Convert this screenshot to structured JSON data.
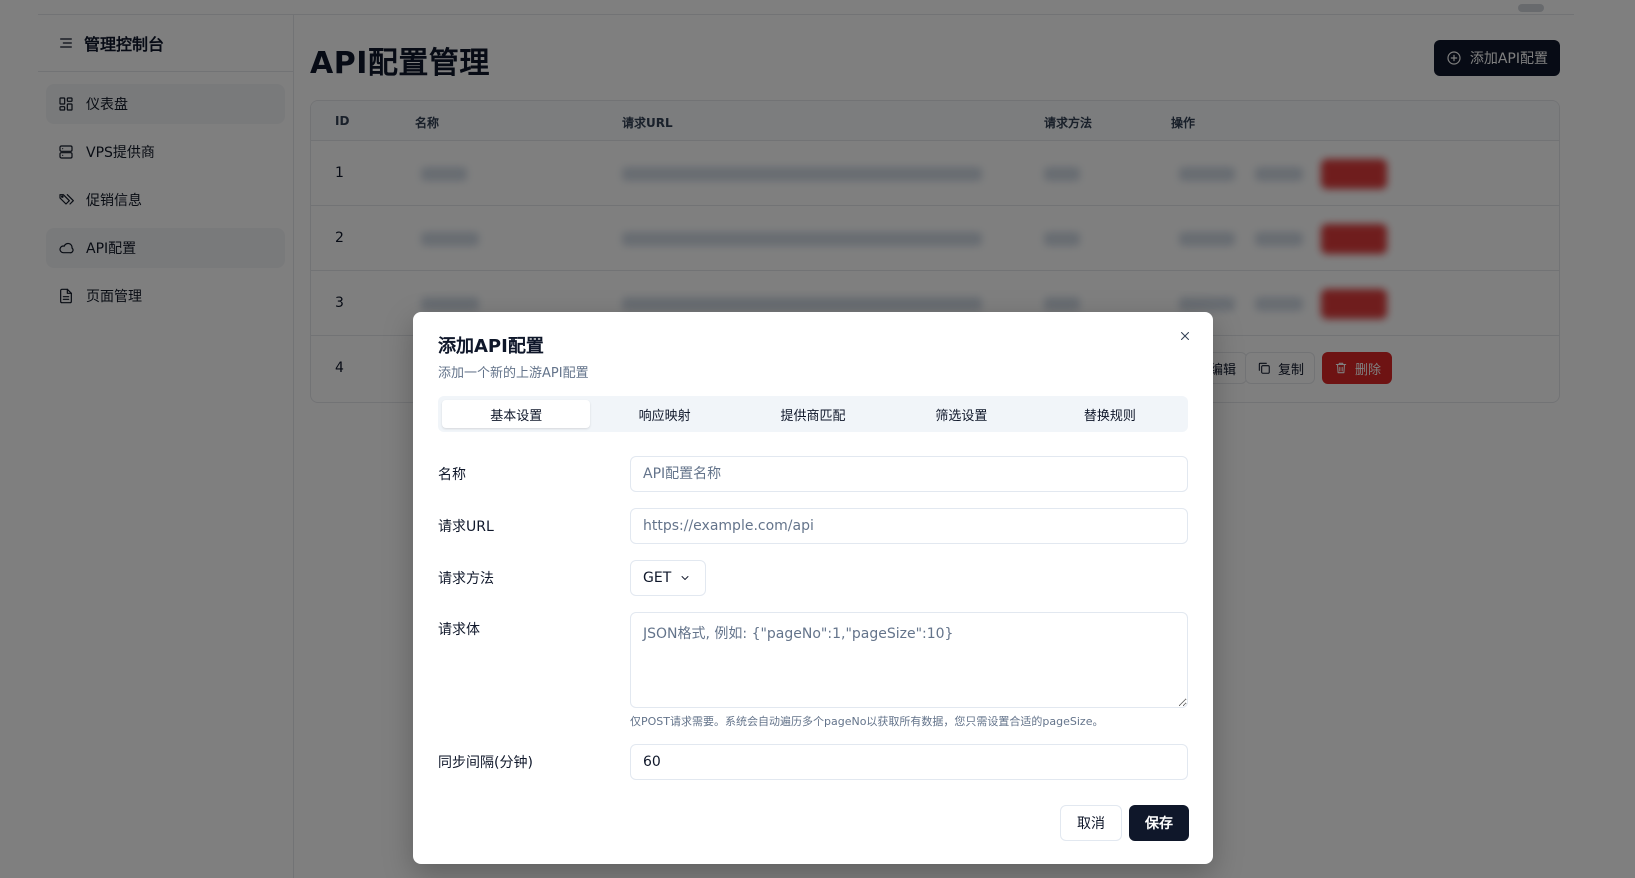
{
  "sidebar": {
    "title": "管理控制台",
    "items": [
      {
        "label": "仪表盘",
        "icon": "dashboard-icon"
      },
      {
        "label": "VPS提供商",
        "icon": "server-icon"
      },
      {
        "label": "促销信息",
        "icon": "tags-icon"
      },
      {
        "label": "API配置",
        "icon": "cloud-icon",
        "active": true
      },
      {
        "label": "页面管理",
        "icon": "file-icon"
      }
    ]
  },
  "main": {
    "title": "API配置管理",
    "add_button": "添加API配置"
  },
  "table": {
    "headers": [
      "ID",
      "名称",
      "请求URL",
      "请求方法",
      "操作"
    ],
    "rows": [
      {
        "id": "1"
      },
      {
        "id": "2"
      },
      {
        "id": "3"
      },
      {
        "id": "4"
      }
    ],
    "actions": {
      "edit": "编辑",
      "copy": "复制",
      "delete": "删除"
    }
  },
  "dialog": {
    "title": "添加API配置",
    "subtitle": "添加一个新的上游API配置",
    "tabs": [
      "基本设置",
      "响应映射",
      "提供商匹配",
      "筛选设置",
      "替换规则"
    ],
    "active_tab": "基本设置",
    "fields": {
      "name": {
        "label": "名称",
        "placeholder": "API配置名称"
      },
      "url": {
        "label": "请求URL",
        "placeholder": "https://example.com/api"
      },
      "method": {
        "label": "请求方法",
        "value": "GET"
      },
      "body": {
        "label": "请求体",
        "placeholder": "JSON格式, 例如: {\"pageNo\":1,\"pageSize\":10}",
        "hint": "仅POST请求需要。系统会自动遍历多个pageNo以获取所有数据，您只需设置合适的pageSize。"
      },
      "interval": {
        "label": "同步间隔(分钟)",
        "value": "60"
      }
    },
    "cancel": "取消",
    "save": "保存"
  },
  "colors": {
    "primary": "#0f172a",
    "danger": "#dc2626",
    "muted": "#64748b",
    "border": "#e2e8f0"
  }
}
